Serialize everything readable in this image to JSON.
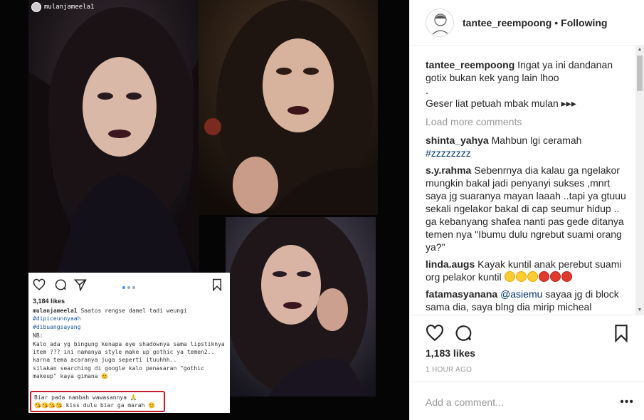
{
  "embedded": {
    "username": "mulanjameela1",
    "likes": "3,184 likes",
    "caption_user": "mulanjameela1",
    "caption_text": " Saatos rengse damel tadi weungi ",
    "caption_tag1": "#dipiceunnyaah",
    "caption_tag2": "#dibuangsayang",
    "nb": "NB:",
    "line1": "Kalo ada yg bingung kenapa eye shadownya sama lipstiknya item ??? ini namanya style make up gothic ya temen2.. karna tema acaranya juga seperti ituuhhh..",
    "line2": "silakan searching di google kalo penasaran \"gothic makeup\" kaya gimana 😊",
    "highlight1": "Biar pada nambah wawasannya 🙏",
    "highlight2": "😘😘😘😘 kiss dulu biar ga marah 😊"
  },
  "header": {
    "username": "tantee_reempoong",
    "separator": "•",
    "follow_status": "Following"
  },
  "caption": {
    "user": "tantee_reempoong",
    "text1": "Ingat ya ini dandanan gotix bukan kek yang lain lhoo",
    "text2": ".",
    "text3": "Geser liat petuah mbak mulan ▸▸▸"
  },
  "load_more": "Load more comments",
  "comments": [
    {
      "user": "shinta_yahya",
      "text": "Mahbun lgi ceramah",
      "link": "#zzzzzzzz"
    },
    {
      "user": "s.y.rahma",
      "text": "Sebenrnya dia kalau ga ngelakor mungkin bakal jadi penyanyi sukses ,mnrt saya jg suaranya mayan laaah ..tapi ya gtuuu sekali ngelakor bakal di cap seumur hidup .. ga kebanyang shafea nanti pas gede ditanya temen nya \"Ibumu dulu ngrebut suami orang ya?\""
    },
    {
      "user": "linda.augs",
      "text": "Kayak kuntil anak perebut suami org pelakor kuntil"
    },
    {
      "user": "fatamasyanana",
      "mention": "@asiemu",
      "text": " sayaa jg di block sama dia, saya blng dia mirip micheal"
    }
  ],
  "likes": "1,183 likes",
  "time": "1 HOUR AGO",
  "add_comment_placeholder": "Add a comment...",
  "more_dots": "•••"
}
